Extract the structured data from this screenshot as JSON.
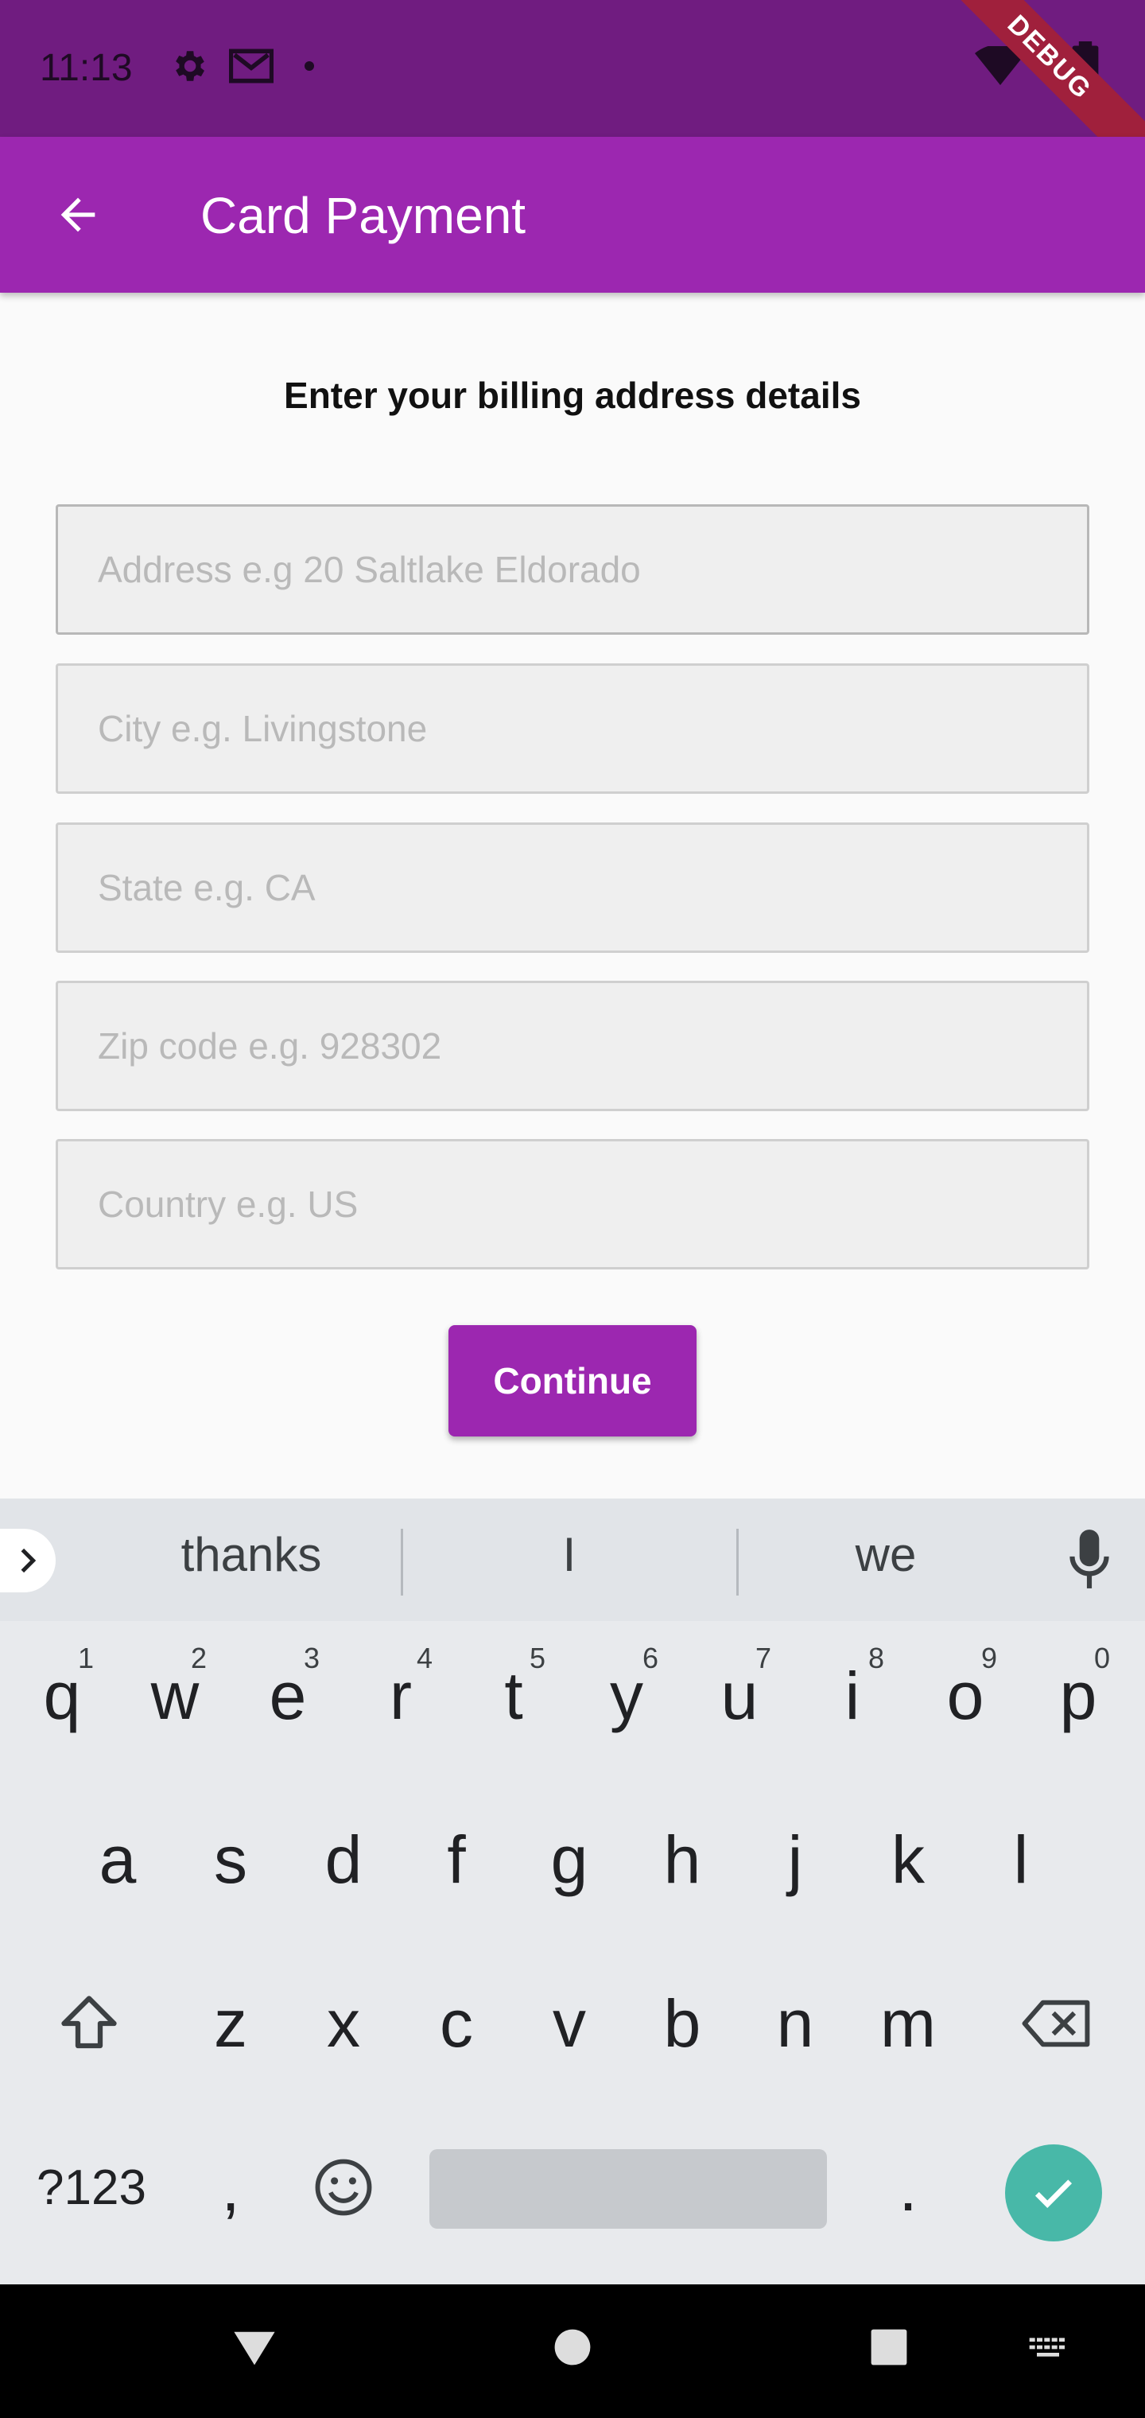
{
  "status_bar": {
    "time": "11:13",
    "icons": [
      "gear-icon",
      "gmail-icon",
      "dot-icon",
      "wifi-icon",
      "battery-icon"
    ],
    "debug_label": "DEBUG"
  },
  "app_bar": {
    "title": "Card Payment",
    "back_icon": "arrow-back-icon",
    "color": "#9c27b0"
  },
  "form": {
    "heading": "Enter your billing address details",
    "fields": [
      {
        "placeholder": "Address e.g 20 Saltlake Eldorado",
        "value": ""
      },
      {
        "placeholder": "City e.g. Livingstone",
        "value": ""
      },
      {
        "placeholder": "State e.g. CA",
        "value": ""
      },
      {
        "placeholder": "Zip code e.g. 928302",
        "value": ""
      },
      {
        "placeholder": "Country e.g. US",
        "value": ""
      }
    ],
    "continue_label": "Continue"
  },
  "keyboard": {
    "suggestions": [
      "thanks",
      "I",
      "we"
    ],
    "row1": [
      "q",
      "w",
      "e",
      "r",
      "t",
      "y",
      "u",
      "i",
      "o",
      "p"
    ],
    "row1_hints": [
      "1",
      "2",
      "3",
      "4",
      "5",
      "6",
      "7",
      "8",
      "9",
      "0"
    ],
    "row2": [
      "a",
      "s",
      "d",
      "f",
      "g",
      "h",
      "j",
      "k",
      "l"
    ],
    "row3": [
      "z",
      "x",
      "c",
      "v",
      "b",
      "n",
      "m"
    ],
    "symbols_label": "?123",
    "comma": ",",
    "period": ".",
    "enter_color": "#48b8a8"
  }
}
